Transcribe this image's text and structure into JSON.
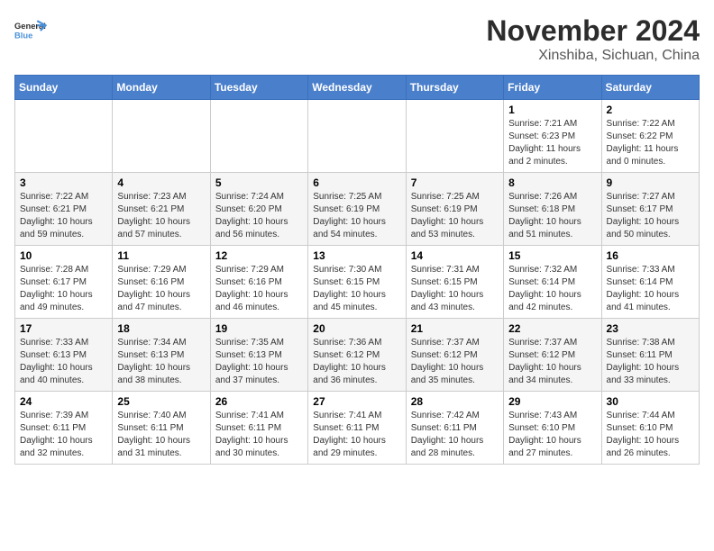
{
  "logo": {
    "line1": "General",
    "line2": "Blue"
  },
  "title": "November 2024",
  "location": "Xinshiba, Sichuan, China",
  "days_of_week": [
    "Sunday",
    "Monday",
    "Tuesday",
    "Wednesday",
    "Thursday",
    "Friday",
    "Saturday"
  ],
  "weeks": [
    [
      {
        "day": "",
        "info": ""
      },
      {
        "day": "",
        "info": ""
      },
      {
        "day": "",
        "info": ""
      },
      {
        "day": "",
        "info": ""
      },
      {
        "day": "",
        "info": ""
      },
      {
        "day": "1",
        "info": "Sunrise: 7:21 AM\nSunset: 6:23 PM\nDaylight: 11 hours and 2 minutes."
      },
      {
        "day": "2",
        "info": "Sunrise: 7:22 AM\nSunset: 6:22 PM\nDaylight: 11 hours and 0 minutes."
      }
    ],
    [
      {
        "day": "3",
        "info": "Sunrise: 7:22 AM\nSunset: 6:21 PM\nDaylight: 10 hours and 59 minutes."
      },
      {
        "day": "4",
        "info": "Sunrise: 7:23 AM\nSunset: 6:21 PM\nDaylight: 10 hours and 57 minutes."
      },
      {
        "day": "5",
        "info": "Sunrise: 7:24 AM\nSunset: 6:20 PM\nDaylight: 10 hours and 56 minutes."
      },
      {
        "day": "6",
        "info": "Sunrise: 7:25 AM\nSunset: 6:19 PM\nDaylight: 10 hours and 54 minutes."
      },
      {
        "day": "7",
        "info": "Sunrise: 7:25 AM\nSunset: 6:19 PM\nDaylight: 10 hours and 53 minutes."
      },
      {
        "day": "8",
        "info": "Sunrise: 7:26 AM\nSunset: 6:18 PM\nDaylight: 10 hours and 51 minutes."
      },
      {
        "day": "9",
        "info": "Sunrise: 7:27 AM\nSunset: 6:17 PM\nDaylight: 10 hours and 50 minutes."
      }
    ],
    [
      {
        "day": "10",
        "info": "Sunrise: 7:28 AM\nSunset: 6:17 PM\nDaylight: 10 hours and 49 minutes."
      },
      {
        "day": "11",
        "info": "Sunrise: 7:29 AM\nSunset: 6:16 PM\nDaylight: 10 hours and 47 minutes."
      },
      {
        "day": "12",
        "info": "Sunrise: 7:29 AM\nSunset: 6:16 PM\nDaylight: 10 hours and 46 minutes."
      },
      {
        "day": "13",
        "info": "Sunrise: 7:30 AM\nSunset: 6:15 PM\nDaylight: 10 hours and 45 minutes."
      },
      {
        "day": "14",
        "info": "Sunrise: 7:31 AM\nSunset: 6:15 PM\nDaylight: 10 hours and 43 minutes."
      },
      {
        "day": "15",
        "info": "Sunrise: 7:32 AM\nSunset: 6:14 PM\nDaylight: 10 hours and 42 minutes."
      },
      {
        "day": "16",
        "info": "Sunrise: 7:33 AM\nSunset: 6:14 PM\nDaylight: 10 hours and 41 minutes."
      }
    ],
    [
      {
        "day": "17",
        "info": "Sunrise: 7:33 AM\nSunset: 6:13 PM\nDaylight: 10 hours and 40 minutes."
      },
      {
        "day": "18",
        "info": "Sunrise: 7:34 AM\nSunset: 6:13 PM\nDaylight: 10 hours and 38 minutes."
      },
      {
        "day": "19",
        "info": "Sunrise: 7:35 AM\nSunset: 6:13 PM\nDaylight: 10 hours and 37 minutes."
      },
      {
        "day": "20",
        "info": "Sunrise: 7:36 AM\nSunset: 6:12 PM\nDaylight: 10 hours and 36 minutes."
      },
      {
        "day": "21",
        "info": "Sunrise: 7:37 AM\nSunset: 6:12 PM\nDaylight: 10 hours and 35 minutes."
      },
      {
        "day": "22",
        "info": "Sunrise: 7:37 AM\nSunset: 6:12 PM\nDaylight: 10 hours and 34 minutes."
      },
      {
        "day": "23",
        "info": "Sunrise: 7:38 AM\nSunset: 6:11 PM\nDaylight: 10 hours and 33 minutes."
      }
    ],
    [
      {
        "day": "24",
        "info": "Sunrise: 7:39 AM\nSunset: 6:11 PM\nDaylight: 10 hours and 32 minutes."
      },
      {
        "day": "25",
        "info": "Sunrise: 7:40 AM\nSunset: 6:11 PM\nDaylight: 10 hours and 31 minutes."
      },
      {
        "day": "26",
        "info": "Sunrise: 7:41 AM\nSunset: 6:11 PM\nDaylight: 10 hours and 30 minutes."
      },
      {
        "day": "27",
        "info": "Sunrise: 7:41 AM\nSunset: 6:11 PM\nDaylight: 10 hours and 29 minutes."
      },
      {
        "day": "28",
        "info": "Sunrise: 7:42 AM\nSunset: 6:11 PM\nDaylight: 10 hours and 28 minutes."
      },
      {
        "day": "29",
        "info": "Sunrise: 7:43 AM\nSunset: 6:10 PM\nDaylight: 10 hours and 27 minutes."
      },
      {
        "day": "30",
        "info": "Sunrise: 7:44 AM\nSunset: 6:10 PM\nDaylight: 10 hours and 26 minutes."
      }
    ]
  ]
}
